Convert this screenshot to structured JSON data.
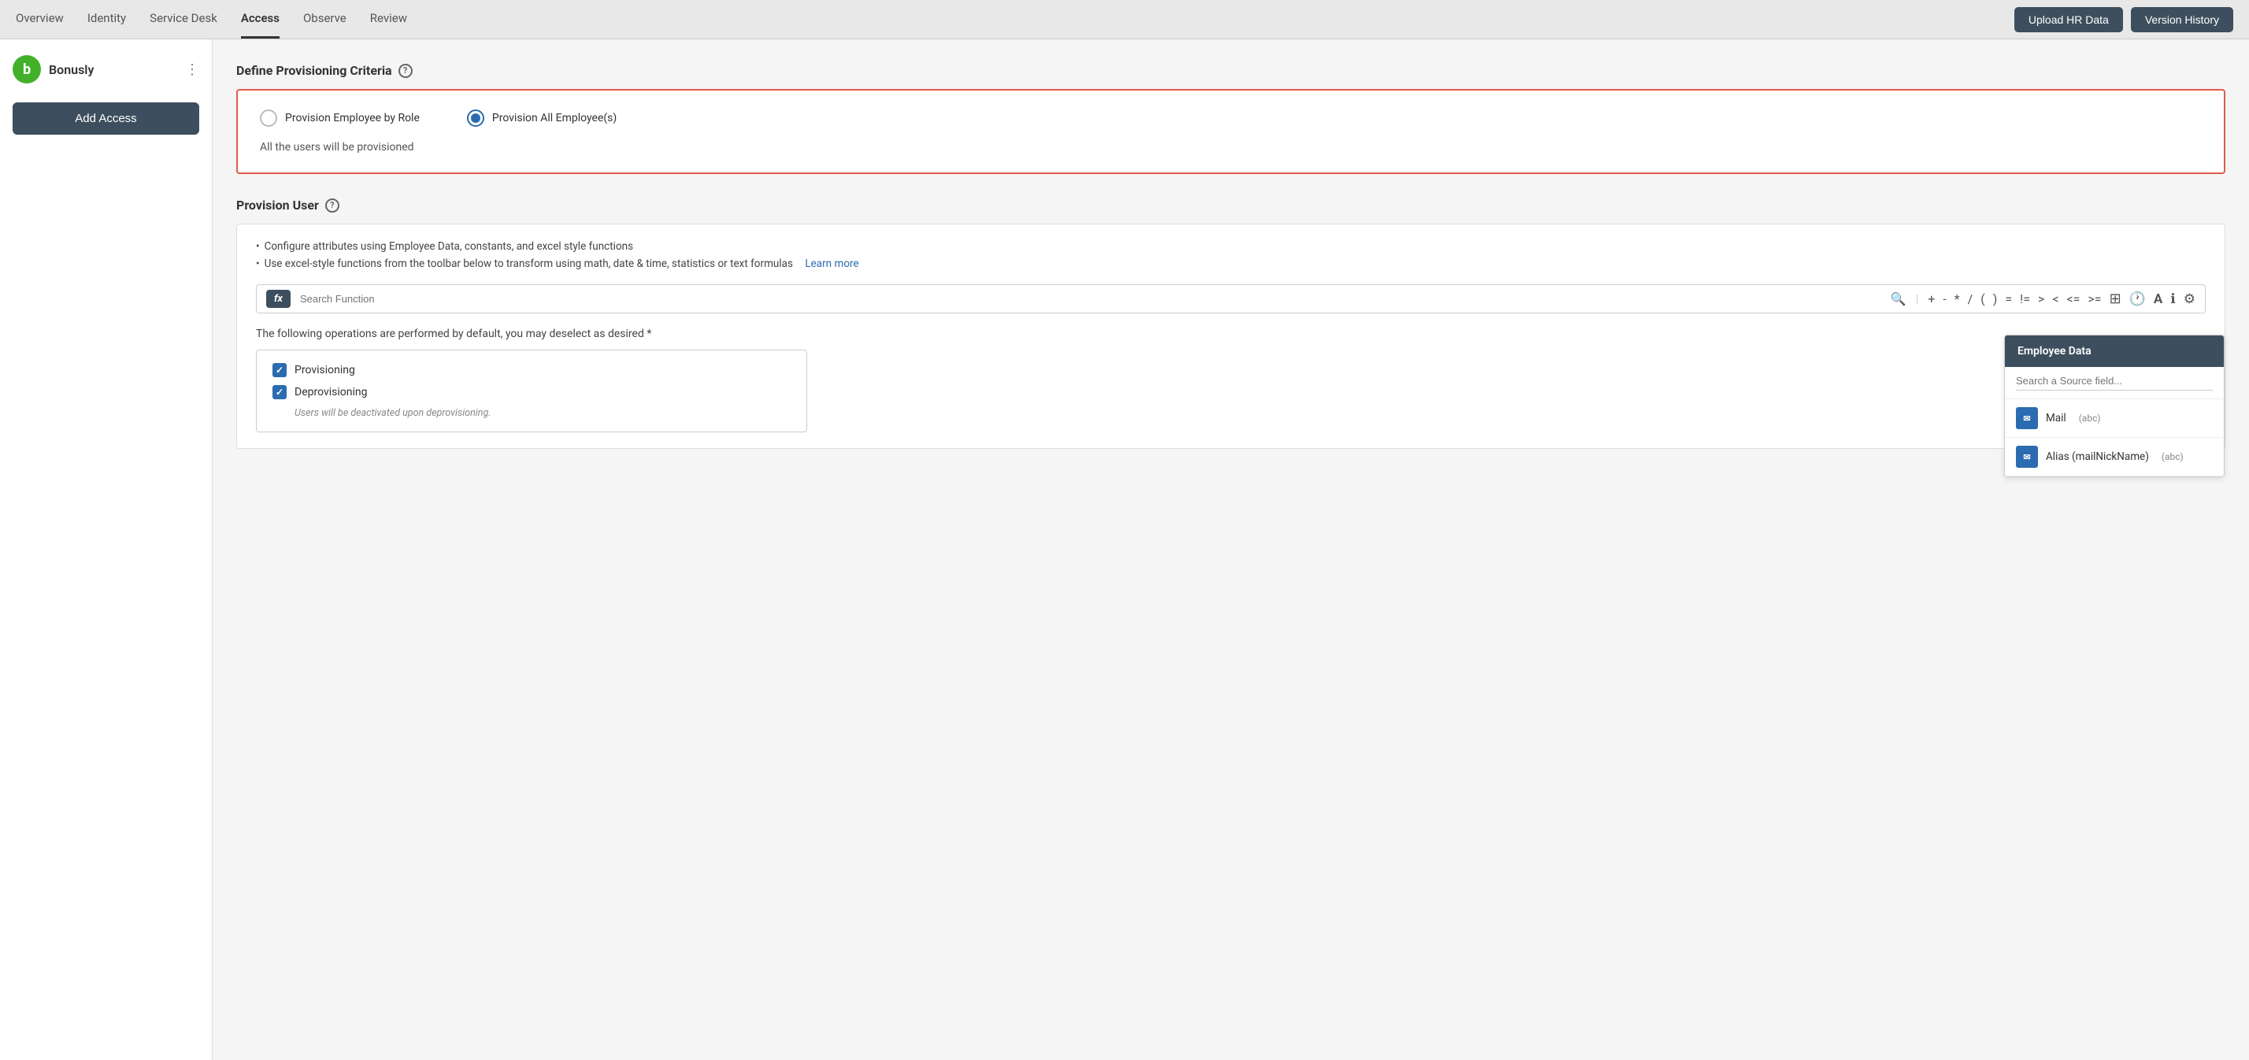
{
  "nav": {
    "items": [
      {
        "label": "Overview",
        "active": false
      },
      {
        "label": "Identity",
        "active": false
      },
      {
        "label": "Service Desk",
        "active": false
      },
      {
        "label": "Access",
        "active": true
      },
      {
        "label": "Observe",
        "active": false
      },
      {
        "label": "Review",
        "active": false
      }
    ],
    "upload_btn": "Upload HR Data",
    "version_btn": "Version History"
  },
  "sidebar": {
    "app_name": "Bonusly",
    "logo_letter": "b",
    "add_access_label": "Add Access"
  },
  "criteria_section": {
    "title": "Define Provisioning Criteria",
    "option1": "Provision Employee by Role",
    "option2": "Provision All Employee(s)",
    "description": "All the users will be provisioned"
  },
  "provision_section": {
    "title": "Provision User",
    "bullet1": "Configure attributes using Employee Data, constants, and excel style functions",
    "bullet2": "Use excel-style functions from the toolbar below to transform using math, date & time, statistics or text formulas",
    "learn_more": "Learn more",
    "search_placeholder": "Search Function",
    "ops": [
      "+",
      "-",
      "*",
      "/",
      "(",
      ")",
      "=",
      "!=",
      ">",
      "<",
      "<=",
      ">="
    ],
    "operations_label": "The following operations are performed by default, you may deselect as desired *",
    "checkbox1": "Provisioning",
    "checkbox2": "Deprovisioning",
    "deprovisioning_note": "Users will be deactivated upon deprovisioning."
  },
  "employee_data_panel": {
    "title": "Employee Data",
    "search_placeholder": "Search a Source field...",
    "fields": [
      {
        "name": "Mail",
        "type": "(abc)"
      },
      {
        "name": "Alias (mailNickName)",
        "type": "(abc)"
      }
    ]
  }
}
